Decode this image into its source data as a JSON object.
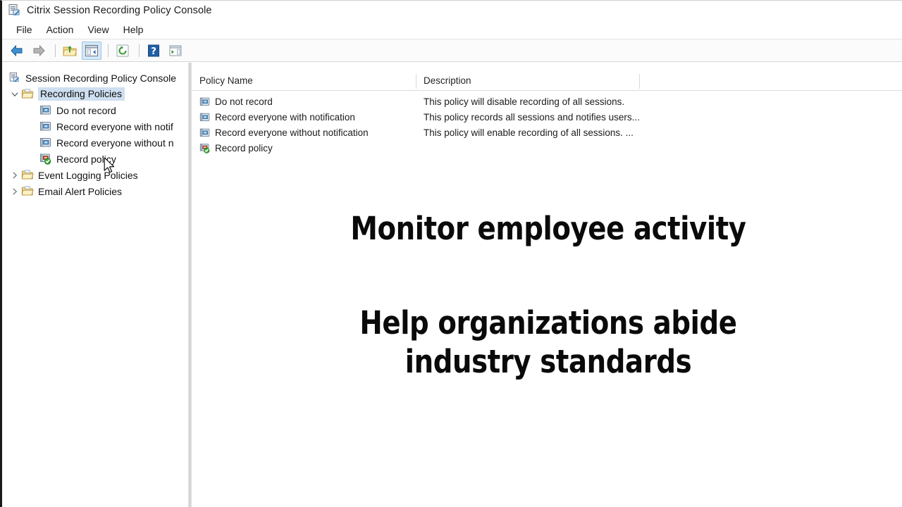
{
  "window": {
    "title": "Citrix Session Recording Policy Console",
    "title_icon": "mmc-console-icon"
  },
  "menu": {
    "items": [
      {
        "label": "File",
        "name": "menu-file"
      },
      {
        "label": "Action",
        "name": "menu-action"
      },
      {
        "label": "View",
        "name": "menu-view"
      },
      {
        "label": "Help",
        "name": "menu-help"
      }
    ]
  },
  "toolbar": {
    "buttons": [
      {
        "name": "back-arrow-icon",
        "tip": "Back"
      },
      {
        "name": "forward-arrow-icon",
        "tip": "Forward"
      },
      {
        "name": "up-one-level-icon",
        "tip": "Up One Level"
      },
      {
        "name": "show-hide-console-tree-icon",
        "tip": "Show/Hide Console Tree",
        "active": true
      },
      {
        "name": "refresh-icon",
        "tip": "Refresh"
      },
      {
        "name": "help-icon",
        "tip": "Help"
      },
      {
        "name": "export-list-icon",
        "tip": "Export List"
      }
    ]
  },
  "tree": {
    "root": {
      "label": "Session Recording Policy Console",
      "icon": "console-root-icon"
    },
    "nodes": [
      {
        "label": "Recording Policies",
        "icon": "folder-open-icon",
        "twisty": "⌄",
        "expanded": true,
        "selected": true,
        "children": [
          {
            "label": "Do not record",
            "icon": "policy-icon"
          },
          {
            "label": "Record everyone with notif",
            "icon": "policy-icon"
          },
          {
            "label": "Record everyone without n",
            "icon": "policy-icon"
          },
          {
            "label": "Record policy",
            "icon": "policy-active-icon"
          }
        ]
      },
      {
        "label": "Event Logging Policies",
        "icon": "folder-open-icon",
        "twisty": "›",
        "expanded": false,
        "selected": false,
        "children": []
      },
      {
        "label": "Email Alert Policies",
        "icon": "folder-open-icon",
        "twisty": "›",
        "expanded": false,
        "selected": false,
        "children": []
      }
    ]
  },
  "list": {
    "columns": [
      {
        "label": "Policy Name",
        "name": "column-policy-name"
      },
      {
        "label": "Description",
        "name": "column-description"
      }
    ],
    "rows": [
      {
        "name": "Do not record",
        "description": "This policy will disable recording of all sessions.",
        "icon": "policy-icon"
      },
      {
        "name": "Record everyone with notification",
        "description": "This policy records all sessions and notifies users...",
        "icon": "policy-icon"
      },
      {
        "name": "Record everyone without notification",
        "description": "This policy will enable recording of all sessions. ...",
        "icon": "policy-icon"
      },
      {
        "name": "Record policy",
        "description": "",
        "icon": "policy-active-icon"
      }
    ]
  },
  "overlay": {
    "line1": "Monitor employee activity",
    "line2a": "Help organizations abide",
    "line2b": "industry standards"
  },
  "colors": {
    "selection_blue": "#cddff0",
    "toolbar_active": "#d5e8f7",
    "text_primary": "#1b1b1b",
    "folder_yellow": "#f5dd8e",
    "accent_green": "#4caf2f",
    "back_arrow_blue": "#2f7fc4"
  }
}
